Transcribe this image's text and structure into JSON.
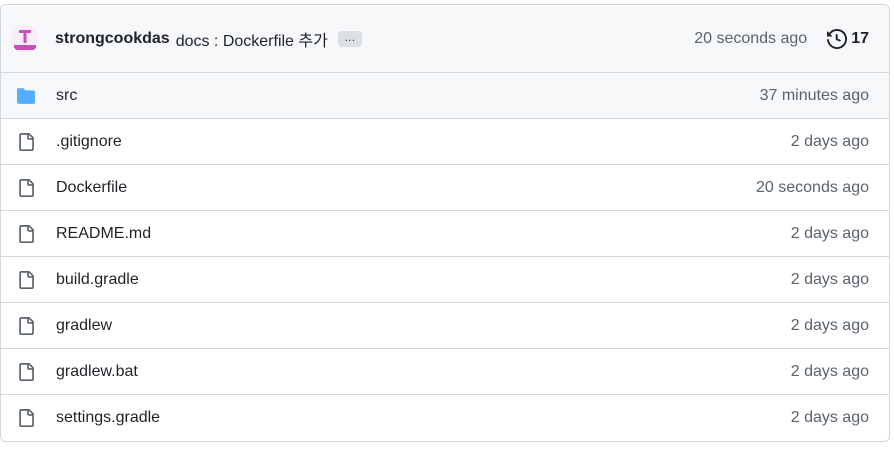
{
  "commit": {
    "author": "strongcookdas",
    "message": "docs : Dockerfile 추가",
    "ellipsis": "…",
    "time": "20 seconds ago",
    "history_count": "17",
    "avatar_letter": "T"
  },
  "files": [
    {
      "name": "src",
      "time": "37 minutes ago",
      "icon": "folder-icon"
    },
    {
      "name": ".gitignore",
      "time": "2 days ago",
      "icon": "file-icon"
    },
    {
      "name": "Dockerfile",
      "time": "20 seconds ago",
      "icon": "file-icon"
    },
    {
      "name": "README.md",
      "time": "2 days ago",
      "icon": "file-icon"
    },
    {
      "name": "build.gradle",
      "time": "2 days ago",
      "icon": "file-icon"
    },
    {
      "name": "gradlew",
      "time": "2 days ago",
      "icon": "file-icon"
    },
    {
      "name": "gradlew.bat",
      "time": "2 days ago",
      "icon": "file-icon"
    },
    {
      "name": "settings.gradle",
      "time": "2 days ago",
      "icon": "file-icon"
    }
  ],
  "colors": {
    "folder": "#54aeff",
    "avatar": "#c94fb9",
    "muted_text": "#59636e",
    "border": "#d0d7de",
    "header_bg": "#f6f8fa"
  }
}
